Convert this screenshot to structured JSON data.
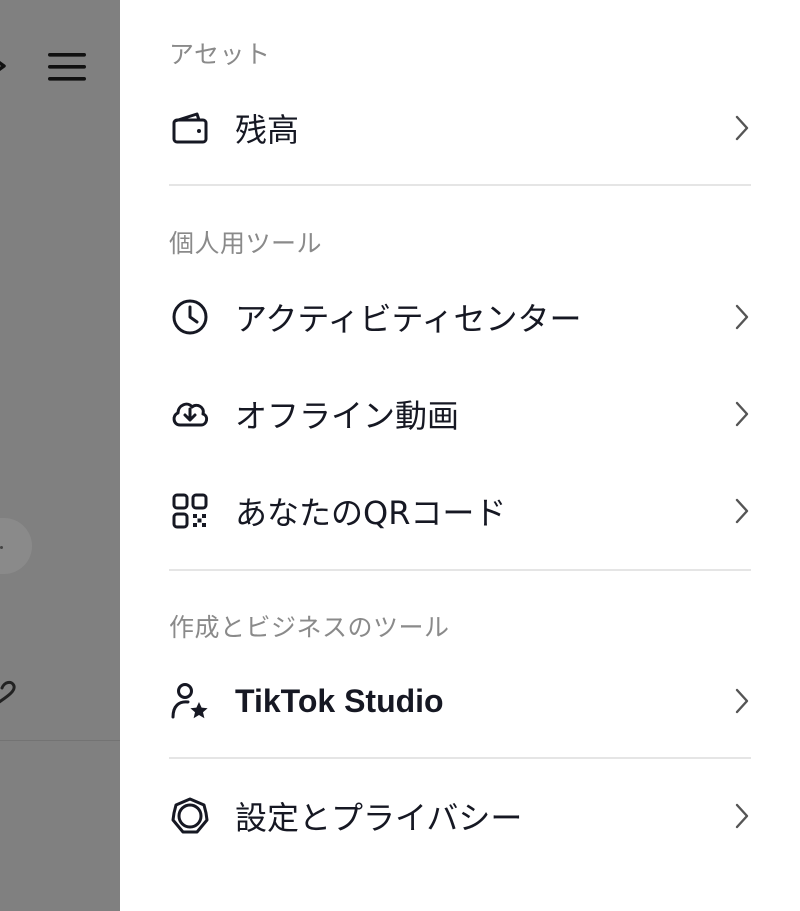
{
  "sections": {
    "assets": {
      "header": "アセット",
      "items": [
        {
          "label": "残高",
          "icon": "wallet-icon"
        }
      ]
    },
    "personal_tools": {
      "header": "個人用ツール",
      "items": [
        {
          "label": "アクティビティセンター",
          "icon": "clock-icon"
        },
        {
          "label": "オフライン動画",
          "icon": "cloud-download-icon"
        },
        {
          "label": "あなたのQRコード",
          "icon": "qr-code-icon"
        }
      ]
    },
    "creator_business": {
      "header": "作成とビジネスのツール",
      "items": [
        {
          "label": "TikTok Studio",
          "icon": "user-star-icon"
        }
      ]
    },
    "settings": {
      "items": [
        {
          "label": "設定とプライバシー",
          "icon": "gear-icon"
        }
      ]
    }
  },
  "colors": {
    "backdrop": "#808080",
    "drawer_bg": "#ffffff",
    "text_primary": "#161823",
    "text_secondary": "#8a8a8a",
    "divider": "#e5e5e5"
  }
}
